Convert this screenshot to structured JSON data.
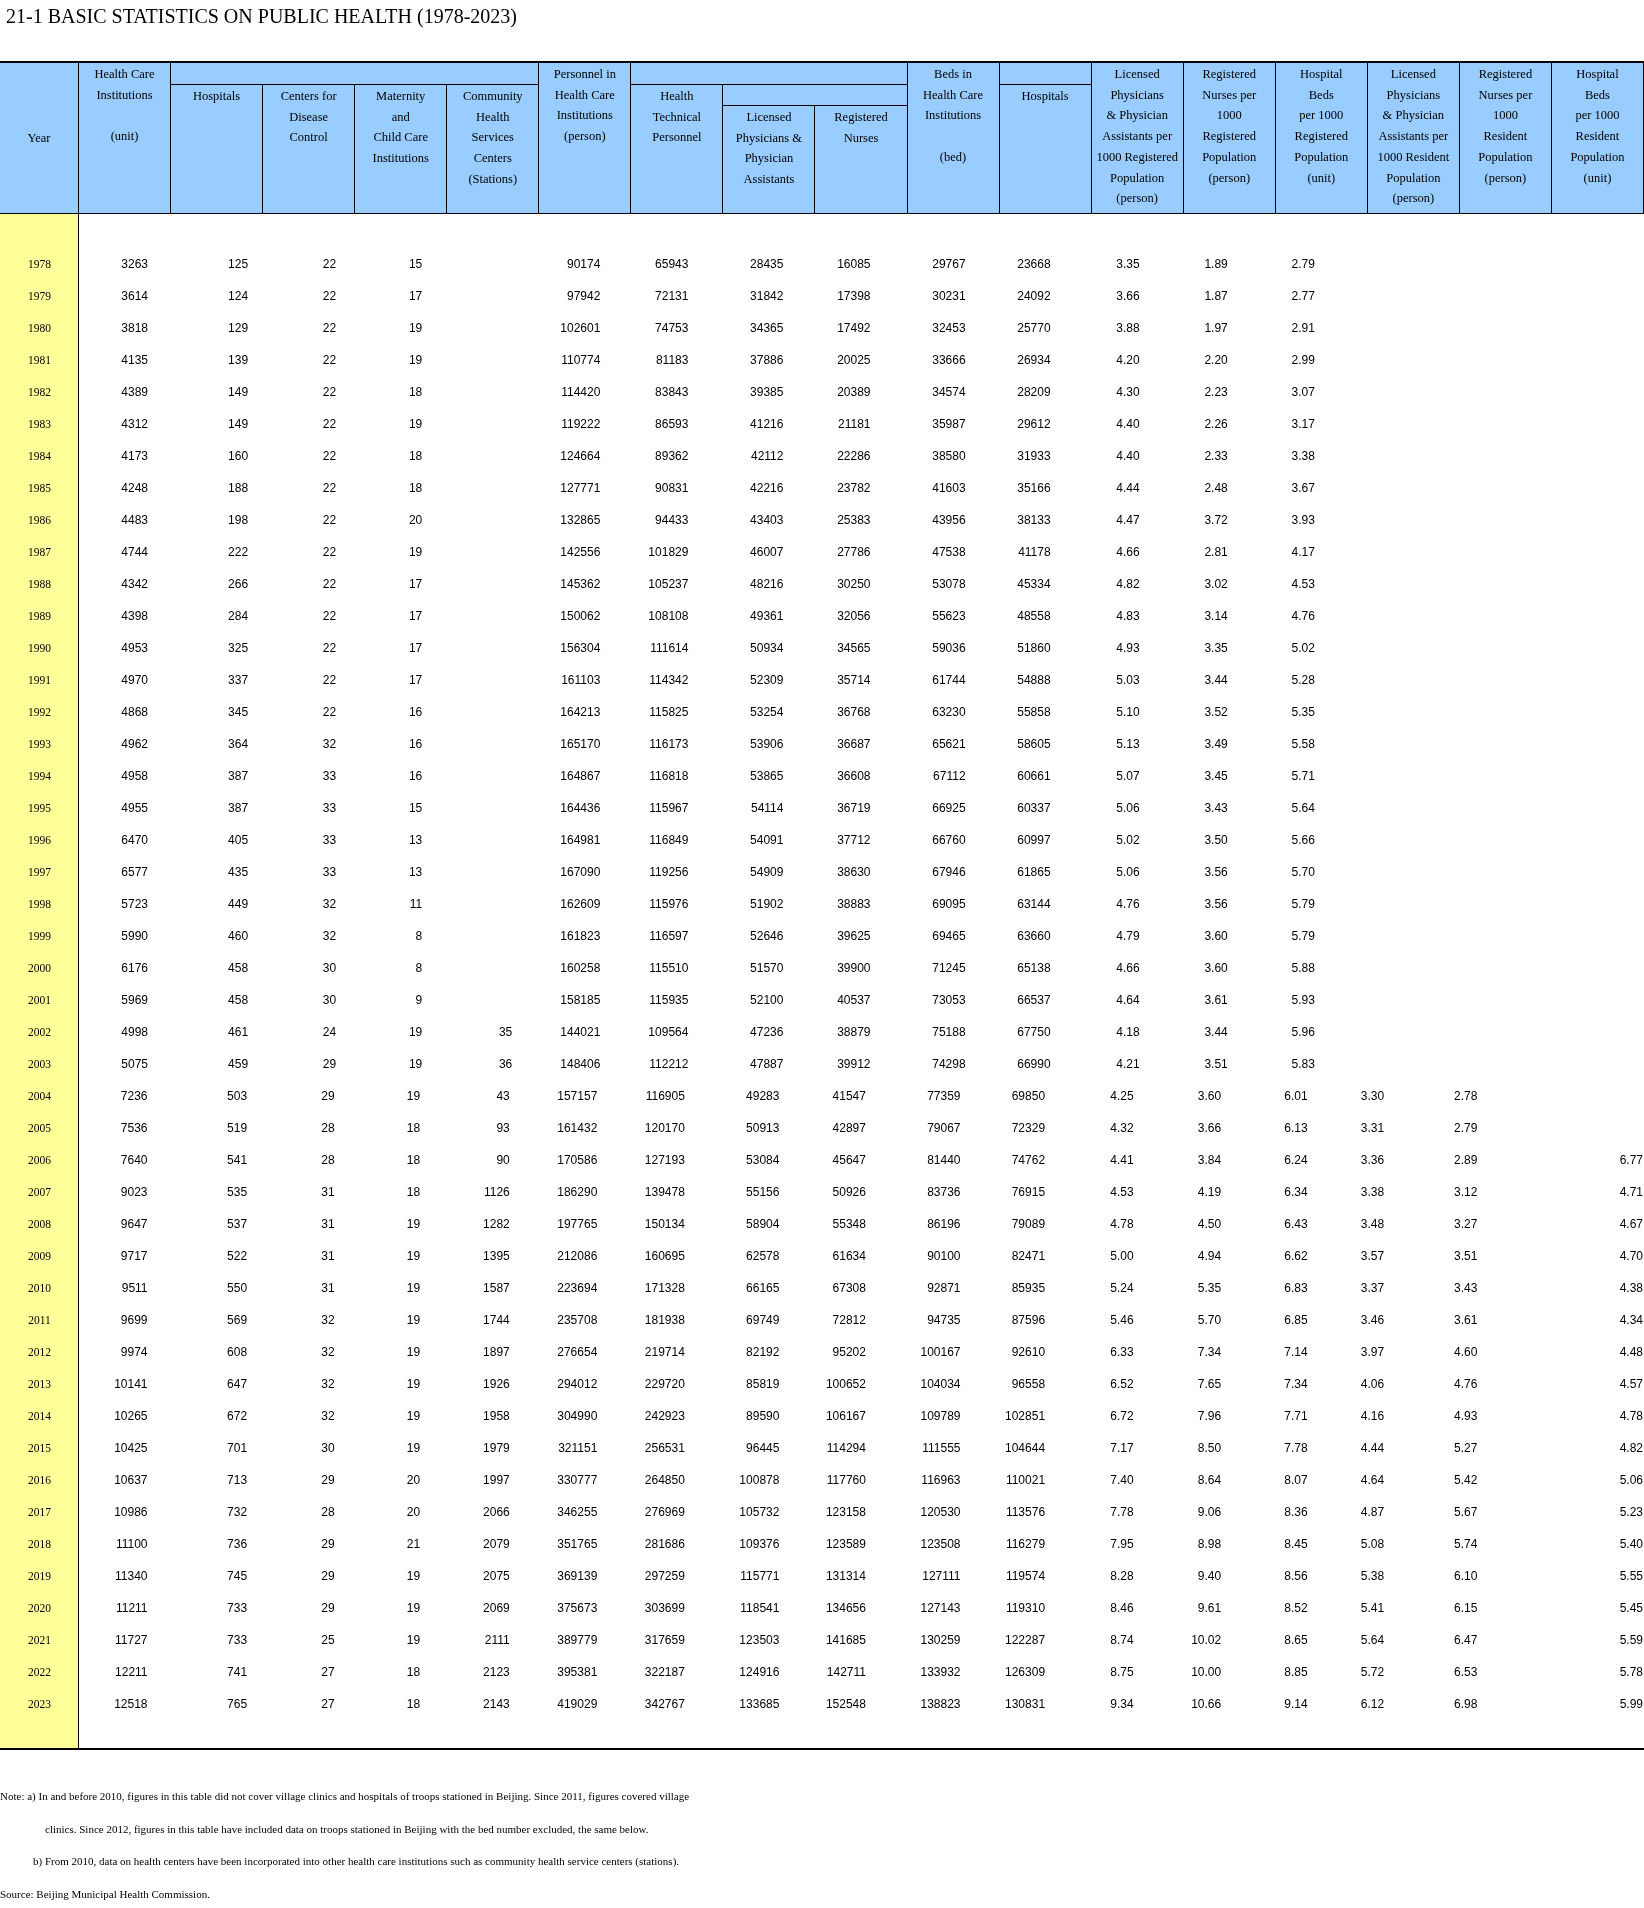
{
  "title": "21-1  BASIC STATISTICS ON PUBLIC HEALTH (1978-2023)",
  "columns": [
    "Year",
    "Health Care\nInstitutions\n\n(unit)",
    "Hospitals",
    "Centers for\nDisease\nControl",
    "Maternity\nand\nChild Care\nInstitutions",
    "Community\nHealth\nServices\nCenters\n(Stations)",
    "Personnel in\nHealth Care\nInstitutions\n(person)",
    "Health\nTechnical\nPersonnel",
    "Licensed\nPhysicians &\nPhysician\nAssistants",
    "Registered\nNurses",
    "Beds in\nHealth Care\nInstitutions\n\n(bed)",
    "Hospitals",
    "Licensed\nPhysicians\n& Physician\nAssistants per\n1000 Registered\nPopulation\n(person)",
    "Registered\nNurses per\n1000\nRegistered\nPopulation\n(person)",
    "Hospital\nBeds\nper 1000\nRegistered\nPopulation\n(unit)",
    "Licensed\nPhysicians\n& Physician\nAssistants per\n1000 Resident\nPopulation\n(person)",
    "Registered\nNurses per\n1000\nResident\nPopulation\n(person)",
    "Hospital\nBeds\nper 1000\nResident\nPopulation\n(unit)"
  ],
  "rows": [
    {
      "year": "1978",
      "institutions": "3263",
      "hospitals": "125",
      "cdc": "22",
      "maternity": "15",
      "personnel": "90174",
      "technical": "65943",
      "physicians": "28435",
      "nurses": "16085",
      "beds": "29767",
      "hospital_beds": "23668",
      "physicians_reg": "3.35",
      "nurses_reg": "1.89",
      "beds_reg": "2.79"
    },
    {
      "year": "1979",
      "institutions": "3614",
      "hospitals": "124",
      "cdc": "22",
      "maternity": "17",
      "personnel": "97942",
      "technical": "72131",
      "physicians": "31842",
      "nurses": "17398",
      "beds": "30231",
      "hospital_beds": "24092",
      "physicians_reg": "3.66",
      "nurses_reg": "1.87",
      "beds_reg": "2.77"
    },
    {
      "year": "1980",
      "institutions": "3818",
      "hospitals": "129",
      "cdc": "22",
      "maternity": "19",
      "personnel": "102601",
      "technical": "74753",
      "physicians": "34365",
      "nurses": "17492",
      "beds": "32453",
      "hospital_beds": "25770",
      "physicians_reg": "3.88",
      "nurses_reg": "1.97",
      "beds_reg": "2.91"
    },
    {
      "year": "1981",
      "institutions": "4135",
      "hospitals": "139",
      "cdc": "22",
      "maternity": "19",
      "personnel": "110774",
      "technical": "81183",
      "physicians": "37886",
      "nurses": "20025",
      "beds": "33666",
      "hospital_beds": "26934",
      "physicians_reg": "4.20",
      "nurses_reg": "2.20",
      "beds_reg": "2.99"
    },
    {
      "year": "1982",
      "institutions": "4389",
      "hospitals": "149",
      "cdc": "22",
      "maternity": "18",
      "personnel": "114420",
      "technical": "83843",
      "physicians": "39385",
      "nurses": "20389",
      "beds": "34574",
      "hospital_beds": "28209",
      "physicians_reg": "4.30",
      "nurses_reg": "2.23",
      "beds_reg": "3.07"
    },
    {
      "year": "1983",
      "institutions": "4312",
      "hospitals": "149",
      "cdc": "22",
      "maternity": "19",
      "personnel": "119222",
      "technical": "86593",
      "physicians": "41216",
      "nurses": "21181",
      "beds": "35987",
      "hospital_beds": "29612",
      "physicians_reg": "4.40",
      "nurses_reg": "2.26",
      "beds_reg": "3.17"
    },
    {
      "year": "1984",
      "institutions": "4173",
      "hospitals": "160",
      "cdc": "22",
      "maternity": "18",
      "personnel": "124664",
      "technical": "89362",
      "physicians": "42112",
      "nurses": "22286",
      "beds": "38580",
      "hospital_beds": "31933",
      "physicians_reg": "4.40",
      "nurses_reg": "2.33",
      "beds_reg": "3.38"
    },
    {
      "year": "1985",
      "institutions": "4248",
      "hospitals": "188",
      "cdc": "22",
      "maternity": "18",
      "personnel": "127771",
      "technical": "90831",
      "physicians": "42216",
      "nurses": "23782",
      "beds": "41603",
      "hospital_beds": "35166",
      "physicians_reg": "4.44",
      "nurses_reg": "2.48",
      "beds_reg": "3.67"
    },
    {
      "year": "1986",
      "institutions": "4483",
      "hospitals": "198",
      "cdc": "22",
      "maternity": "20",
      "personnel": "132865",
      "technical": "94433",
      "physicians": "43403",
      "nurses": "25383",
      "beds": "43956",
      "hospital_beds": "38133",
      "physicians_reg": "4.47",
      "nurses_reg": "3.72",
      "beds_reg": "3.93"
    },
    {
      "year": "1987",
      "institutions": "4744",
      "hospitals": "222",
      "cdc": "22",
      "maternity": "19",
      "personnel": "142556",
      "technical": "101829",
      "physicians": "46007",
      "nurses": "27786",
      "beds": "47538",
      "hospital_beds": "41178",
      "physicians_reg": "4.66",
      "nurses_reg": "2.81",
      "beds_reg": "4.17"
    },
    {
      "year": "1988",
      "institutions": "4342",
      "hospitals": "266",
      "cdc": "22",
      "maternity": "17",
      "personnel": "145362",
      "technical": "105237",
      "physicians": "48216",
      "nurses": "30250",
      "beds": "53078",
      "hospital_beds": "45334",
      "physicians_reg": "4.82",
      "nurses_reg": "3.02",
      "beds_reg": "4.53"
    },
    {
      "year": "1989",
      "institutions": "4398",
      "hospitals": "284",
      "cdc": "22",
      "maternity": "17",
      "personnel": "150062",
      "technical": "108108",
      "physicians": "49361",
      "nurses": "32056",
      "beds": "55623",
      "hospital_beds": "48558",
      "physicians_reg": "4.83",
      "nurses_reg": "3.14",
      "beds_reg": "4.76"
    },
    {
      "year": "1990",
      "institutions": "4953",
      "hospitals": "325",
      "cdc": "22",
      "maternity": "17",
      "personnel": "156304",
      "technical": "111614",
      "physicians": "50934",
      "nurses": "34565",
      "beds": "59036",
      "hospital_beds": "51860",
      "physicians_reg": "4.93",
      "nurses_reg": "3.35",
      "beds_reg": "5.02"
    },
    {
      "year": "1991",
      "institutions": "4970",
      "hospitals": "337",
      "cdc": "22",
      "maternity": "17",
      "personnel": "161103",
      "technical": "114342",
      "physicians": "52309",
      "nurses": "35714",
      "beds": "61744",
      "hospital_beds": "54888",
      "physicians_reg": "5.03",
      "nurses_reg": "3.44",
      "beds_reg": "5.28"
    },
    {
      "year": "1992",
      "institutions": "4868",
      "hospitals": "345",
      "cdc": "22",
      "maternity": "16",
      "personnel": "164213",
      "technical": "115825",
      "physicians": "53254",
      "nurses": "36768",
      "beds": "63230",
      "hospital_beds": "55858",
      "physicians_reg": "5.10",
      "nurses_reg": "3.52",
      "beds_reg": "5.35"
    },
    {
      "year": "1993",
      "institutions": "4962",
      "hospitals": "364",
      "cdc": "32",
      "maternity": "16",
      "personnel": "165170",
      "technical": "116173",
      "physicians": "53906",
      "nurses": "36687",
      "beds": "65621",
      "hospital_beds": "58605",
      "physicians_reg": "5.13",
      "nurses_reg": "3.49",
      "beds_reg": "5.58"
    },
    {
      "year": "1994",
      "institutions": "4958",
      "hospitals": "387",
      "cdc": "33",
      "maternity": "16",
      "personnel": "164867",
      "technical": "116818",
      "physicians": "53865",
      "nurses": "36608",
      "beds": "67112",
      "hospital_beds": "60661",
      "physicians_reg": "5.07",
      "nurses_reg": "3.45",
      "beds_reg": "5.71"
    },
    {
      "year": "1995",
      "institutions": "4955",
      "hospitals": "387",
      "cdc": "33",
      "maternity": "15",
      "personnel": "164436",
      "technical": "115967",
      "physicians": "54114",
      "nurses": "36719",
      "beds": "66925",
      "hospital_beds": "60337",
      "physicians_reg": "5.06",
      "nurses_reg": "3.43",
      "beds_reg": "5.64"
    },
    {
      "year": "1996",
      "institutions": "6470",
      "hospitals": "405",
      "cdc": "33",
      "maternity": "13",
      "personnel": "164981",
      "technical": "116849",
      "physicians": "54091",
      "nurses": "37712",
      "beds": "66760",
      "hospital_beds": "60997",
      "physicians_reg": "5.02",
      "nurses_reg": "3.50",
      "beds_reg": "5.66"
    },
    {
      "year": "1997",
      "institutions": "6577",
      "hospitals": "435",
      "cdc": "33",
      "maternity": "13",
      "personnel": "167090",
      "technical": "119256",
      "physicians": "54909",
      "nurses": "38630",
      "beds": "67946",
      "hospital_beds": "61865",
      "physicians_reg": "5.06",
      "nurses_reg": "3.56",
      "beds_reg": "5.70"
    },
    {
      "year": "1998",
      "institutions": "5723",
      "hospitals": "449",
      "cdc": "32",
      "maternity": "11",
      "personnel": "162609",
      "technical": "115976",
      "physicians": "51902",
      "nurses": "38883",
      "beds": "69095",
      "hospital_beds": "63144",
      "physicians_reg": "4.76",
      "nurses_reg": "3.56",
      "beds_reg": "5.79"
    },
    {
      "year": "1999",
      "institutions": "5990",
      "hospitals": "460",
      "cdc": "32",
      "maternity": "8",
      "personnel": "161823",
      "technical": "116597",
      "physicians": "52646",
      "nurses": "39625",
      "beds": "69465",
      "hospital_beds": "63660",
      "physicians_reg": "4.79",
      "nurses_reg": "3.60",
      "beds_reg": "5.79"
    },
    {
      "year": "2000",
      "institutions": "6176",
      "hospitals": "458",
      "cdc": "30",
      "maternity": "8",
      "personnel": "160258",
      "technical": "115510",
      "physicians": "51570",
      "nurses": "39900",
      "beds": "71245",
      "hospital_beds": "65138",
      "physicians_reg": "4.66",
      "nurses_reg": "3.60",
      "beds_reg": "5.88"
    },
    {
      "year": "2001",
      "institutions": "5969",
      "hospitals": "458",
      "cdc": "30",
      "maternity": "9",
      "personnel": "158185",
      "technical": "115935",
      "physicians": "52100",
      "nurses": "40537",
      "beds": "73053",
      "hospital_beds": "66537",
      "physicians_reg": "4.64",
      "nurses_reg": "3.61",
      "beds_reg": "5.93"
    },
    {
      "year": "2002",
      "institutions": "4998",
      "hospitals": "461",
      "cdc": "24",
      "maternity": "19",
      "community": "35",
      "personnel": "144021",
      "technical": "109564",
      "physicians": "47236",
      "nurses": "38879",
      "beds": "75188",
      "hospital_beds": "67750",
      "physicians_reg": "4.18",
      "nurses_reg": "3.44",
      "beds_reg": "5.96"
    },
    {
      "year": "2003",
      "institutions": "5075",
      "hospitals": "459",
      "cdc": "29",
      "maternity": "19",
      "community": "36",
      "personnel": "148406",
      "technical": "112212",
      "physicians": "47887",
      "nurses": "39912",
      "beds": "74298",
      "hospital_beds": "66990",
      "physicians_reg": "4.21",
      "nurses_reg": "3.51",
      "beds_reg": "5.83"
    },
    {
      "year": "2004",
      "institutions": "7236",
      "hospitals": "503",
      "cdc": "29",
      "maternity": "19",
      "community": "43",
      "personnel": "157157",
      "technical": "116905",
      "physicians": "49283",
      "nurses": "41547",
      "beds": "77359",
      "hospital_beds": "69850",
      "physicians_reg": "4.25",
      "nurses_reg": "3.60",
      "beds_reg": "6.01",
      "physicians_res": "3.30",
      "nurses_res": "2.78"
    },
    {
      "year": "2005",
      "institutions": "7536",
      "hospitals": "519",
      "cdc": "28",
      "maternity": "18",
      "community": "93",
      "personnel": "161432",
      "technical": "120170",
      "physicians": "50913",
      "nurses": "42897",
      "beds": "79067",
      "hospital_beds": "72329",
      "physicians_reg": "4.32",
      "nurses_reg": "3.66",
      "beds_reg": "6.13",
      "physicians_res": "3.31",
      "nurses_res": "2.79"
    },
    {
      "year": "2006",
      "institutions": "7640",
      "hospitals": "541",
      "cdc": "28",
      "maternity": "18",
      "community": "90",
      "personnel": "170586",
      "technical": "127193",
      "physicians": "53084",
      "nurses": "45647",
      "beds": "81440",
      "hospital_beds": "74762",
      "physicians_reg": "4.41",
      "nurses_reg": "3.84",
      "beds_reg": "6.24",
      "physicians_res": "3.36",
      "nurses_res": "2.89",
      "beds_res": "6.77"
    },
    {
      "year": "2007",
      "institutions": "9023",
      "hospitals": "535",
      "cdc": "31",
      "maternity": "18",
      "community": "1126",
      "personnel": "186290",
      "technical": "139478",
      "physicians": "55156",
      "nurses": "50926",
      "beds": "83736",
      "hospital_beds": "76915",
      "physicians_reg": "4.53",
      "nurses_reg": "4.19",
      "beds_reg": "6.34",
      "physicians_res": "3.38",
      "nurses_res": "3.12",
      "beds_res": "4.71"
    },
    {
      "year": "2008",
      "institutions": "9647",
      "hospitals": "537",
      "cdc": "31",
      "maternity": "19",
      "community": "1282",
      "personnel": "197765",
      "technical": "150134",
      "physicians": "58904",
      "nurses": "55348",
      "beds": "86196",
      "hospital_beds": "79089",
      "physicians_reg": "4.78",
      "nurses_reg": "4.50",
      "beds_reg": "6.43",
      "physicians_res": "3.48",
      "nurses_res": "3.27",
      "beds_res": "4.67"
    },
    {
      "year": "2009",
      "institutions": "9717",
      "hospitals": "522",
      "cdc": "31",
      "maternity": "19",
      "community": "1395",
      "personnel": "212086",
      "technical": "160695",
      "physicians": "62578",
      "nurses": "61634",
      "beds": "90100",
      "hospital_beds": "82471",
      "physicians_reg": "5.00",
      "nurses_reg": "4.94",
      "beds_reg": "6.62",
      "physicians_res": "3.57",
      "nurses_res": "3.51",
      "beds_res": "4.70"
    },
    {
      "year": "2010",
      "institutions": "9511",
      "hospitals": "550",
      "cdc": "31",
      "maternity": "19",
      "community": "1587",
      "personnel": "223694",
      "technical": "171328",
      "physicians": "66165",
      "nurses": "67308",
      "beds": "92871",
      "hospital_beds": "85935",
      "physicians_reg": "5.24",
      "nurses_reg": "5.35",
      "beds_reg": "6.83",
      "physicians_res": "3.37",
      "nurses_res": "3.43",
      "beds_res": "4.38"
    },
    {
      "year": "2011",
      "institutions": "9699",
      "hospitals": "569",
      "cdc": "32",
      "maternity": "19",
      "community": "1744",
      "personnel": "235708",
      "technical": "181938",
      "physicians": "69749",
      "nurses": "72812",
      "beds": "94735",
      "hospital_beds": "87596",
      "physicians_reg": "5.46",
      "nurses_reg": "5.70",
      "beds_reg": "6.85",
      "physicians_res": "3.46",
      "nurses_res": "3.61",
      "beds_res": "4.34"
    },
    {
      "year": "2012",
      "institutions": "9974",
      "hospitals": "608",
      "cdc": "32",
      "maternity": "19",
      "community": "1897",
      "personnel": "276654",
      "technical": "219714",
      "physicians": "82192",
      "nurses": "95202",
      "beds": "100167",
      "hospital_beds": "92610",
      "physicians_reg": "6.33",
      "nurses_reg": "7.34",
      "beds_reg": "7.14",
      "physicians_res": "3.97",
      "nurses_res": "4.60",
      "beds_res": "4.48"
    },
    {
      "year": "2013",
      "institutions": "10141",
      "hospitals": "647",
      "cdc": "32",
      "maternity": "19",
      "community": "1926",
      "personnel": "294012",
      "technical": "229720",
      "physicians": "85819",
      "nurses": "100652",
      "beds": "104034",
      "hospital_beds": "96558",
      "physicians_reg": "6.52",
      "nurses_reg": "7.65",
      "beds_reg": "7.34",
      "physicians_res": "4.06",
      "nurses_res": "4.76",
      "beds_res": "4.57"
    },
    {
      "year": "2014",
      "institutions": "10265",
      "hospitals": "672",
      "cdc": "32",
      "maternity": "19",
      "community": "1958",
      "personnel": "304990",
      "technical": "242923",
      "physicians": "89590",
      "nurses": "106167",
      "beds": "109789",
      "hospital_beds": "102851",
      "physicians_reg": "6.72",
      "nurses_reg": "7.96",
      "beds_reg": "7.71",
      "physicians_res": "4.16",
      "nurses_res": "4.93",
      "beds_res": "4.78"
    },
    {
      "year": "2015",
      "institutions": "10425",
      "hospitals": "701",
      "cdc": "30",
      "maternity": "19",
      "community": "1979",
      "personnel": "321151",
      "technical": "256531",
      "physicians": "96445",
      "nurses": "114294",
      "beds": "111555",
      "hospital_beds": "104644",
      "physicians_reg": "7.17",
      "nurses_reg": "8.50",
      "beds_reg": "7.78",
      "physicians_res": "4.44",
      "nurses_res": "5.27",
      "beds_res": "4.82"
    },
    {
      "year": "2016",
      "institutions": "10637",
      "hospitals": "713",
      "cdc": "29",
      "maternity": "20",
      "community": "1997",
      "personnel": "330777",
      "technical": "264850",
      "physicians": "100878",
      "nurses": "117760",
      "beds": "116963",
      "hospital_beds": "110021",
      "physicians_reg": "7.40",
      "nurses_reg": "8.64",
      "beds_reg": "8.07",
      "physicians_res": "4.64",
      "nurses_res": "5.42",
      "beds_res": "5.06"
    },
    {
      "year": "2017",
      "institutions": "10986",
      "hospitals": "732",
      "cdc": "28",
      "maternity": "20",
      "community": "2066",
      "personnel": "346255",
      "technical": "276969",
      "physicians": "105732",
      "nurses": "123158",
      "beds": "120530",
      "hospital_beds": "113576",
      "physicians_reg": "7.78",
      "nurses_reg": "9.06",
      "beds_reg": "8.36",
      "physicians_res": "4.87",
      "nurses_res": "5.67",
      "beds_res": "5.23"
    },
    {
      "year": "2018",
      "institutions": "11100",
      "hospitals": "736",
      "cdc": "29",
      "maternity": "21",
      "community": "2079",
      "personnel": "351765",
      "technical": "281686",
      "physicians": "109376",
      "nurses": "123589",
      "beds": "123508",
      "hospital_beds": "116279",
      "physicians_reg": "7.95",
      "nurses_reg": "8.98",
      "beds_reg": "8.45",
      "physicians_res": "5.08",
      "nurses_res": "5.74",
      "beds_res": "5.40"
    },
    {
      "year": "2019",
      "institutions": "11340",
      "hospitals": "745",
      "cdc": "29",
      "maternity": "19",
      "community": "2075",
      "personnel": "369139",
      "technical": "297259",
      "physicians": "115771",
      "nurses": "131314",
      "beds": "127111",
      "hospital_beds": "119574",
      "physicians_reg": "8.28",
      "nurses_reg": "9.40",
      "beds_reg": "8.56",
      "physicians_res": "5.38",
      "nurses_res": "6.10",
      "beds_res": "5.55"
    },
    {
      "year": "2020",
      "institutions": "11211",
      "hospitals": "733",
      "cdc": "29",
      "maternity": "19",
      "community": "2069",
      "personnel": "375673",
      "technical": "303699",
      "physicians": "118541",
      "nurses": "134656",
      "beds": "127143",
      "hospital_beds": "119310",
      "physicians_reg": "8.46",
      "nurses_reg": "9.61",
      "beds_reg": "8.52",
      "physicians_res": "5.41",
      "nurses_res": "6.15",
      "beds_res": "5.45"
    },
    {
      "year": "2021",
      "institutions": "11727",
      "hospitals": "733",
      "cdc": "25",
      "maternity": "19",
      "community": "2111",
      "personnel": "389779",
      "technical": "317659",
      "physicians": "123503",
      "nurses": "141685",
      "beds": "130259",
      "hospital_beds": "122287",
      "physicians_reg": "8.74",
      "nurses_reg": "10.02",
      "beds_reg": "8.65",
      "physicians_res": "5.64",
      "nurses_res": "6.47",
      "beds_res": "5.59"
    },
    {
      "year": "2022",
      "institutions": "12211",
      "hospitals": "741",
      "cdc": "27",
      "maternity": "18",
      "community": "2123",
      "personnel": "395381",
      "technical": "322187",
      "physicians": "124916",
      "nurses": "142711",
      "beds": "133932",
      "hospital_beds": "126309",
      "physicians_reg": "8.75",
      "nurses_reg": "10.00",
      "beds_reg": "8.85",
      "physicians_res": "5.72",
      "nurses_res": "6.53",
      "beds_res": "5.78"
    },
    {
      "year": "2023",
      "institutions": "12518",
      "hospitals": "765",
      "cdc": "27",
      "maternity": "18",
      "community": "2143",
      "personnel": "419029",
      "technical": "342767",
      "physicians": "133685",
      "nurses": "152548",
      "beds": "138823",
      "hospital_beds": "130831",
      "physicians_reg": "9.34",
      "nurses_reg": "10.66",
      "beds_reg": "9.14",
      "physicians_res": "6.12",
      "nurses_res": "6.98",
      "beds_res": "5.99"
    }
  ],
  "notes": [
    "Note: a) In and before 2010, figures in this table did not cover village clinics and hospitals of troops stationed in Beijing. Since 2011, figures covered village",
    "clinics. Since 2012, figures in this table have included data on troops stationed in Beijing with the bed number excluded, the same below.",
    "b) From 2010, data on health centers have been incorporated into other health care institutions such as community health service centers (stations)."
  ],
  "source": "Source: Beijing Municipal Health Commission."
}
